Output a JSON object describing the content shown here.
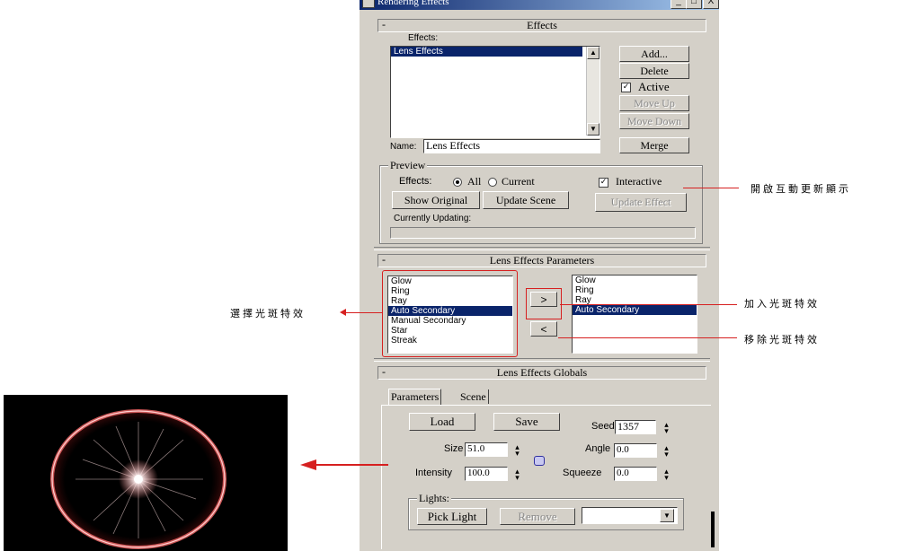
{
  "window": {
    "title": "Rendering Effects",
    "controls": [
      "_",
      "□",
      "X"
    ]
  },
  "effects_rollout": {
    "title": "Effects",
    "toggle": "-",
    "list_label": "Effects:",
    "list_items": [
      "Lens Effects"
    ],
    "buttons": {
      "add": "Add...",
      "delete": "Delete",
      "active": "Active",
      "move_up": "Move Up",
      "move_down": "Move Down",
      "merge": "Merge"
    },
    "active_checked": true,
    "name_label": "Name:",
    "name_value": "Lens Effects",
    "preview": {
      "title": "Preview",
      "effects_label": "Effects:",
      "radio_all": "All",
      "radio_current": "Current",
      "selected": "All",
      "interactive_label": "Interactive",
      "interactive_checked": true,
      "show_original": "Show Original",
      "update_scene": "Update Scene",
      "update_effect": "Update Effect",
      "currently_updating": "Currently Updating:"
    }
  },
  "params_rollout": {
    "title": "Lens Effects Parameters",
    "toggle": "-",
    "available": [
      "Glow",
      "Ring",
      "Ray",
      "Auto Secondary",
      "Manual Secondary",
      "Star",
      "Streak"
    ],
    "available_selected": "Auto Secondary",
    "added": [
      "Glow",
      "Ring",
      "Ray",
      "Auto Secondary"
    ],
    "added_selected": "Auto Secondary",
    "add_button": ">",
    "remove_button": "<"
  },
  "globals_rollout": {
    "title": "Lens Effects Globals",
    "toggle": "-",
    "tabs": [
      "Parameters",
      "Scene"
    ],
    "load": "Load",
    "save": "Save",
    "seed_label": "Seed",
    "seed_value": "1357",
    "size_label": "Size",
    "size_value": "51.0",
    "angle_label": "Angle",
    "angle_value": "0.0",
    "intensity_label": "Intensity",
    "intensity_value": "100.0",
    "squeeze_label": "Squeeze",
    "squeeze_value": "0.0",
    "lights_group": "Lights:",
    "pick_light": "Pick Light",
    "remove": "Remove",
    "lights_dropdown_value": ""
  },
  "annotations": {
    "interactive_note": "開啟互動更新顯示",
    "select_note": "選擇光斑特效",
    "add_note": "加入光斑特效",
    "remove_note": "移除光斑特效"
  },
  "colors": {
    "annotation_red": "#d62020",
    "selection": "#0a246a",
    "panel": "#d4d0c8"
  }
}
